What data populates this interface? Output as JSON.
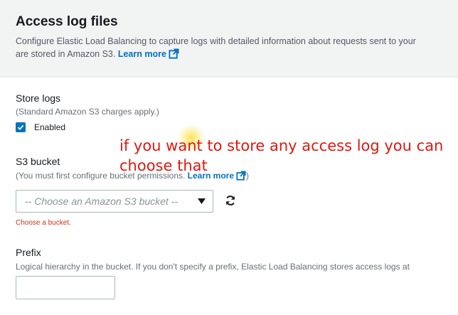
{
  "header": {
    "title": "Access log files",
    "description_line1": "Configure Elastic Load Balancing to capture logs with detailed information about requests sent to your",
    "description_line2": "are stored in Amazon S3.",
    "learn_more": "Learn more"
  },
  "store_logs": {
    "label": "Store logs",
    "hint": "(Standard Amazon S3 charges apply.)",
    "checkbox_label": "Enabled",
    "checked": true
  },
  "s3_bucket": {
    "label": "S3 bucket",
    "hint": "(You must first configure bucket permissions.",
    "learn_more": "Learn more",
    "hint_close": ")",
    "select_placeholder": "-- Choose an Amazon S3 bucket --",
    "error": "Choose a bucket."
  },
  "prefix": {
    "label": "Prefix",
    "hint": "Logical hierarchy in the bucket. If you don't specify a prefix, Elastic Load Balancing stores access logs at",
    "value": ""
  },
  "annotation": {
    "text": "if you want to store any access log you can choose that"
  },
  "colors": {
    "link": "#0073bb",
    "checkbox": "#0073bb",
    "error": "#d13212",
    "annotation": "#e0180f"
  }
}
